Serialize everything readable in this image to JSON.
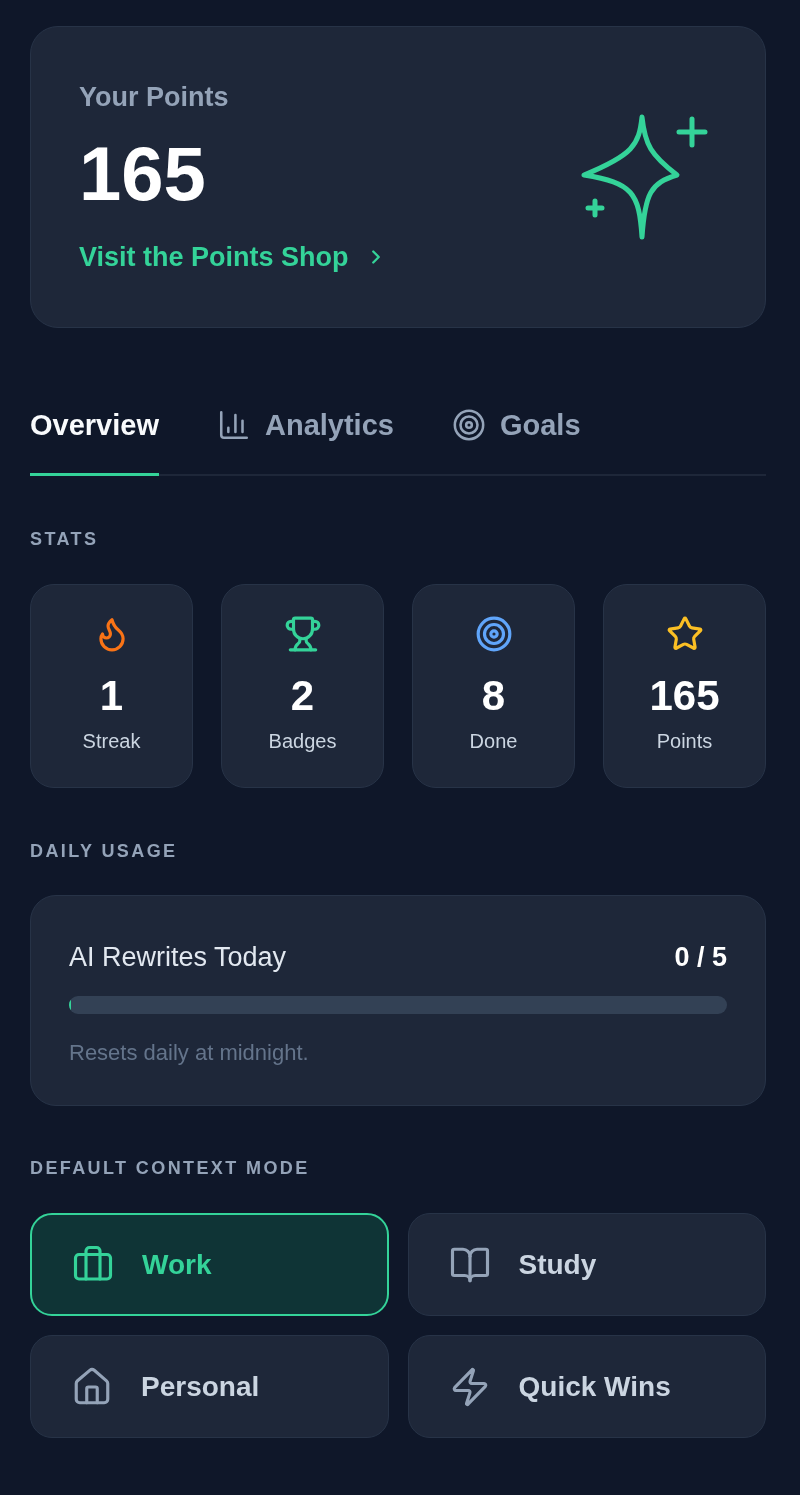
{
  "points_card": {
    "label": "Your Points",
    "value": "165",
    "link": "Visit the Points Shop"
  },
  "tabs": [
    {
      "label": "Overview",
      "selected": true
    },
    {
      "label": "Analytics",
      "selected": false
    },
    {
      "label": "Goals",
      "selected": false
    }
  ],
  "stats": {
    "heading": "STATS",
    "items": [
      {
        "value": "1",
        "label": "Streak",
        "color": "#f97316"
      },
      {
        "value": "2",
        "label": "Badges",
        "color": "#34d399"
      },
      {
        "value": "8",
        "label": "Done",
        "color": "#60a5fa"
      },
      {
        "value": "165",
        "label": "Points",
        "color": "#fbbf24"
      }
    ]
  },
  "daily_usage": {
    "heading": "DAILY USAGE",
    "title": "AI Rewrites Today",
    "count": "0 / 5",
    "level": 0,
    "note": "Resets daily at midnight."
  },
  "context_mode": {
    "heading": "DEFAULT CONTEXT MODE",
    "options": [
      {
        "label": "Work",
        "selected": true
      },
      {
        "label": "Study",
        "selected": false
      },
      {
        "label": "Personal",
        "selected": false
      },
      {
        "label": "Quick Wins",
        "selected": false
      }
    ]
  }
}
